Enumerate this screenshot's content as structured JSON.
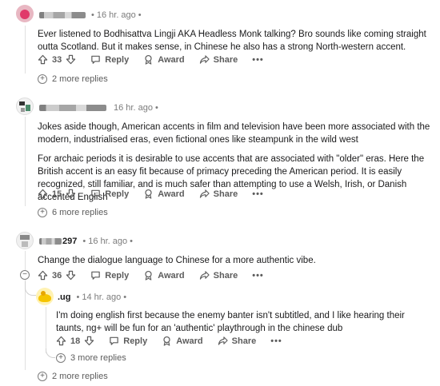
{
  "colors": {
    "upvote": "#5c5c5c",
    "text": "#1a1a1b",
    "meta": "#7c7c7c"
  },
  "comments": [
    {
      "username": "▪ _ ` ' §9§6§1",
      "time": "16 hr. ago",
      "paragraphs": [
        "Ever listened to Bodhisattva Lingji AKA Headless Monk talking? Bro sounds like coming straight outta Scotland. But it makes sense, in Chinese he also has a strong North-western accent."
      ],
      "votes": "33",
      "reply_label": "Reply",
      "award_label": "Award",
      "share_label": "Share",
      "more_replies": "2 more replies"
    },
    {
      "username": "",
      "time": "16 hr. ago",
      "paragraphs": [
        "Jokes aside though, American accents in film and television have been more associated with the modern, industrialised eras, even fictional ones like steampunk in the wild west",
        "For archaic periods it is desirable to use accents that are associated with \"older\" eras. Here the British accent is an easy fit because of primacy preceding the American period. It is easily recognized, still familiar, and is much safer than attempting to use a Welsh, Irish, or Danish accented English"
      ],
      "votes": "15",
      "reply_label": "Reply",
      "award_label": "Award",
      "share_label": "Share",
      "more_replies": "6 more replies"
    },
    {
      "username": "297",
      "time": "16 hr. ago",
      "paragraphs": [
        "Change the dialogue language to Chinese for a more authentic vibe."
      ],
      "votes": "36",
      "reply_label": "Reply",
      "award_label": "Award",
      "share_label": "Share",
      "collapse_symbol": "−",
      "more_replies": "2 more replies"
    },
    {
      "username": ".ug",
      "time": "14 hr. ago",
      "paragraphs": [
        "I'm doing english first because the enemy banter isn't subtitled, and I like hearing their taunts, ng+ will be fun for an 'authentic' playthrough in the chinese dub"
      ],
      "votes": "18",
      "reply_label": "Reply",
      "award_label": "Award",
      "share_label": "Share",
      "more_replies": "3 more replies"
    }
  ],
  "icons": {
    "upvote": "upvote-icon",
    "downvote": "downvote-icon",
    "reply": "reply-icon",
    "award": "award-icon",
    "share": "share-icon",
    "more": "more-options-icon"
  },
  "more_symbol": "•••",
  "meta_dot": "•",
  "plus_symbol": "+"
}
